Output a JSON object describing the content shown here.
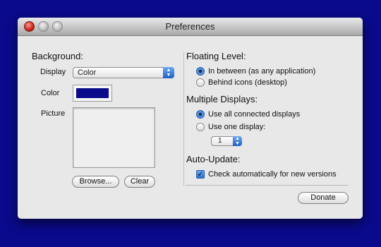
{
  "window": {
    "title": "Preferences"
  },
  "background": {
    "heading": "Background:",
    "display_label": "Display",
    "display_value": "Color",
    "color_label": "Color",
    "swatch_color": "#0a0a8c",
    "picture_label": "Picture",
    "browse_label": "Browse...",
    "clear_label": "Clear"
  },
  "floating_level": {
    "heading": "Floating Level:",
    "options": [
      {
        "label": "In between (as any application)",
        "selected": true
      },
      {
        "label": "Behind icons (desktop)",
        "selected": false
      }
    ]
  },
  "multiple_displays": {
    "heading": "Multiple Displays:",
    "options": [
      {
        "label": "Use all connected displays",
        "selected": true
      },
      {
        "label": "Use one display:",
        "selected": false
      }
    ],
    "display_number": "1"
  },
  "auto_update": {
    "heading": "Auto-Update:",
    "check_label": "Check automatically for new versions",
    "checked": true
  },
  "donate_label": "Donate"
}
